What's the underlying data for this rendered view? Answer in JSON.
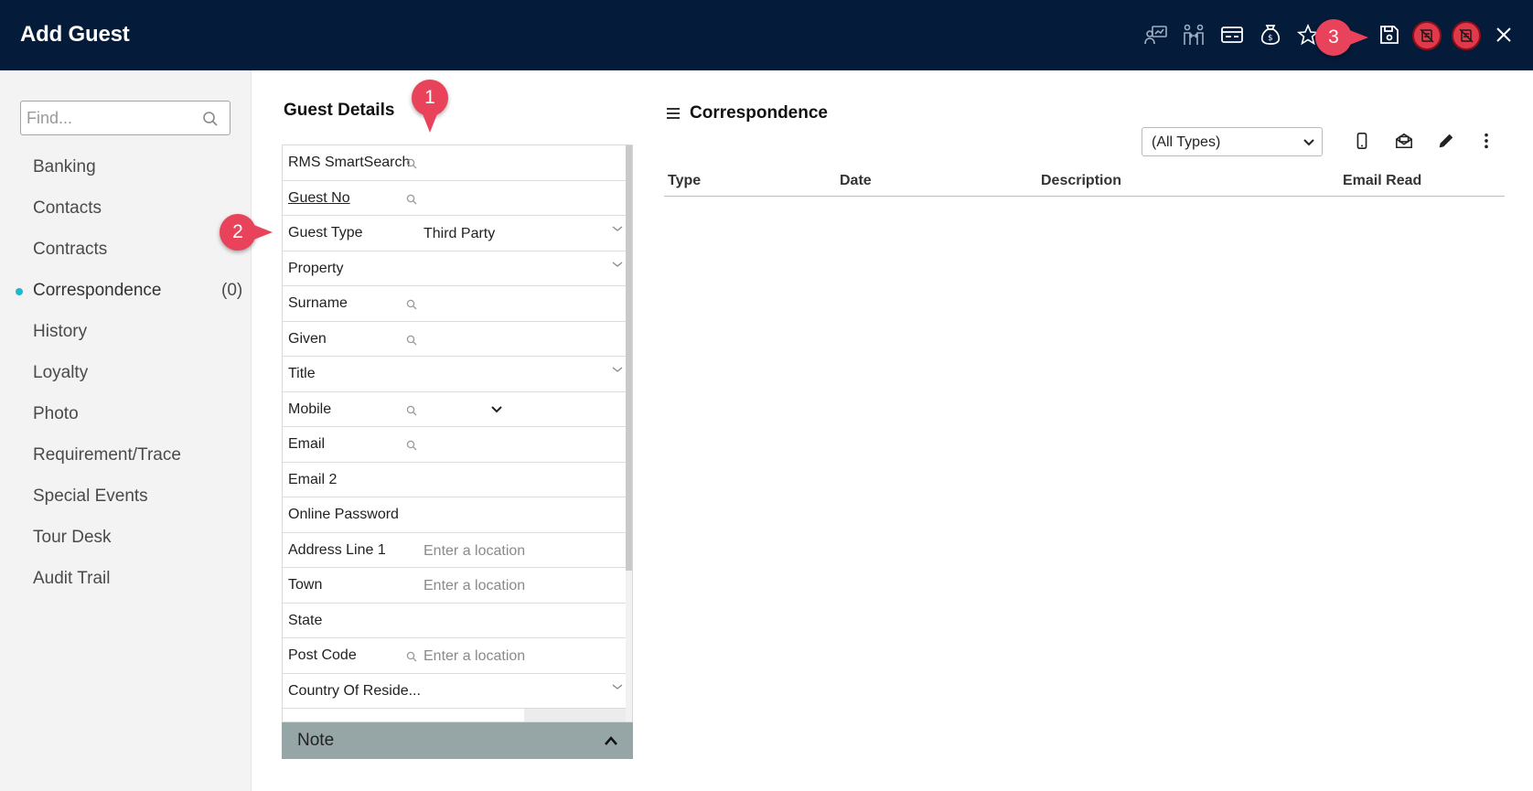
{
  "header": {
    "title": "Add Guest",
    "icons": [
      "presentation-chart-icon",
      "people-link-icon",
      "id-card-icon",
      "money-bag-icon",
      "star-icon",
      "save-icon",
      "no-document-icon",
      "no-document-alt-icon",
      "close-icon"
    ]
  },
  "sidebar": {
    "search_placeholder": "Find...",
    "items": [
      {
        "label": "Banking"
      },
      {
        "label": "Contacts"
      },
      {
        "label": "Contracts"
      },
      {
        "label": "Correspondence",
        "count": "(0)",
        "active": true
      },
      {
        "label": "History"
      },
      {
        "label": "Loyalty"
      },
      {
        "label": "Photo"
      },
      {
        "label": "Requirement/Trace"
      },
      {
        "label": "Special Events"
      },
      {
        "label": "Tour Desk"
      },
      {
        "label": "Audit Trail"
      }
    ]
  },
  "guest_details": {
    "title": "Guest Details",
    "fields": [
      {
        "label": "RMS SmartSearch",
        "value": "",
        "placeholder": ""
      },
      {
        "label": "Guest No",
        "value": "",
        "placeholder": ""
      },
      {
        "label": "Guest Type",
        "value": "Third Party",
        "placeholder": ""
      },
      {
        "label": "Property",
        "value": "",
        "placeholder": ""
      },
      {
        "label": "Surname",
        "value": "",
        "placeholder": ""
      },
      {
        "label": "Given",
        "value": "",
        "placeholder": ""
      },
      {
        "label": "Title",
        "value": "",
        "placeholder": ""
      },
      {
        "label": "Mobile",
        "value": "",
        "placeholder": ""
      },
      {
        "label": "Email",
        "value": "",
        "placeholder": ""
      },
      {
        "label": "Email 2",
        "value": "",
        "placeholder": ""
      },
      {
        "label": "Online Password",
        "value": "",
        "placeholder": ""
      },
      {
        "label": "Address Line 1",
        "value": "",
        "placeholder": "Enter a location"
      },
      {
        "label": "Town",
        "value": "",
        "placeholder": "Enter a location"
      },
      {
        "label": "State",
        "value": "",
        "placeholder": ""
      },
      {
        "label": "Post Code",
        "value": "",
        "placeholder": "Enter a location"
      },
      {
        "label": "Country Of Reside...",
        "value": "",
        "placeholder": ""
      }
    ],
    "note_label": "Note"
  },
  "correspondence": {
    "title": "Correspondence",
    "filter_value": "(All Types)",
    "columns": [
      "Type",
      "Date",
      "Description",
      "Email Read"
    ],
    "rows": []
  },
  "markers": [
    "1",
    "2",
    "3"
  ],
  "colors": {
    "header_bg": "#051b3a",
    "accent_dot": "#23b8c8",
    "marker": "#e8435a",
    "note_bar": "#96a5a6"
  }
}
